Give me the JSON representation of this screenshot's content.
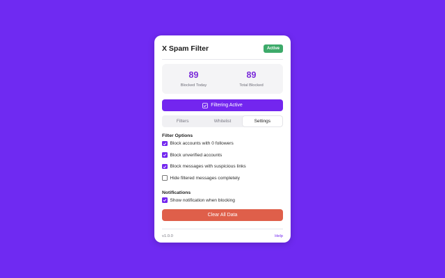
{
  "app": {
    "title": "X Spam Filter",
    "status_badge": "Active"
  },
  "stats": [
    {
      "value": "89",
      "label": "Blocked Today"
    },
    {
      "value": "89",
      "label": "Total Blocked"
    }
  ],
  "filter_button": {
    "label": "Filtering Active",
    "icon": "checkbox-icon"
  },
  "tabs": [
    {
      "label": "Filters",
      "active": false
    },
    {
      "label": "Whitelist",
      "active": false
    },
    {
      "label": "Settings",
      "active": true
    }
  ],
  "filter_options": {
    "title": "Filter Options",
    "items": [
      {
        "label": "Block accounts with 0 followers",
        "checked": true
      },
      {
        "label": "Block unverified accounts",
        "checked": true
      },
      {
        "label": "Block messages with suspicious links",
        "checked": true
      },
      {
        "label": "Hide filtered messages completely",
        "checked": false
      }
    ]
  },
  "notifications": {
    "title": "Notifications",
    "items": [
      {
        "label": "Show notification when blocking",
        "checked": true
      }
    ]
  },
  "clear_button": {
    "label": "Clear All Data"
  },
  "footer": {
    "version": "v1.0.0",
    "help": "Help"
  },
  "colors": {
    "background": "#6f2af2",
    "primary": "#7326ef",
    "stat_value": "#7a2bd9",
    "active_badge": "#3daa6a",
    "danger": "#df5f4a"
  }
}
